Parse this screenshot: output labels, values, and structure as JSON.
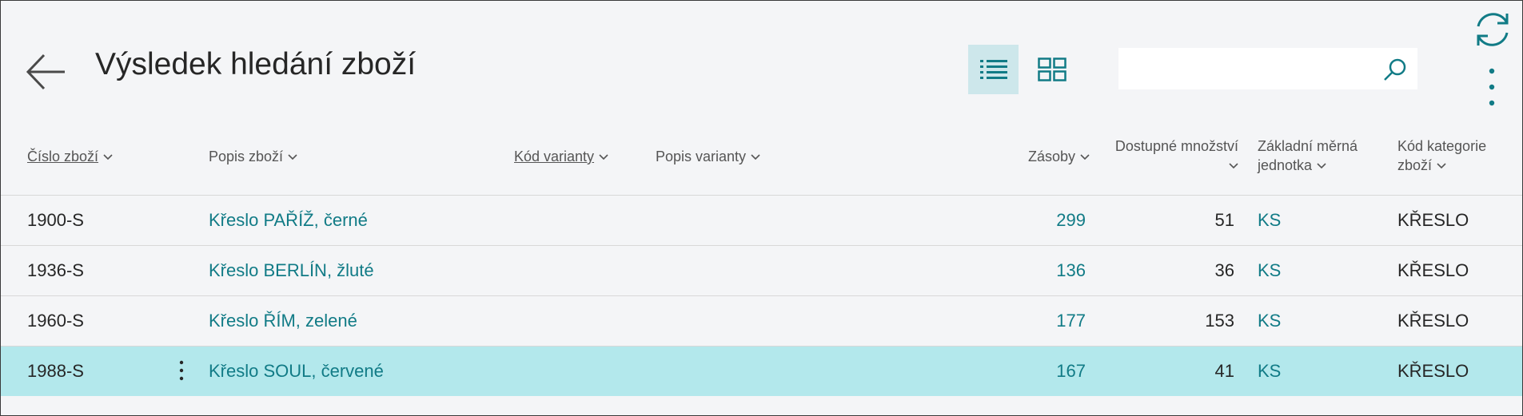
{
  "page": {
    "title": "Výsledek hledání zboží",
    "accent_color": "#117b86",
    "selected_row_color": "#b3e8ec"
  },
  "toolbar": {
    "back_icon": "arrow-left-icon",
    "list_view_icon": "list-icon",
    "tile_view_icon": "tiles-icon",
    "search_placeholder": "",
    "search_value": "",
    "search_icon": "search-icon",
    "refresh_icon": "refresh-icon",
    "more_icon": "more-vertical-icon"
  },
  "columns": {
    "item_no": "Číslo zboží",
    "description": "Popis zboží",
    "variant_code": "Kód varianty",
    "variant_desc": "Popis varianty",
    "inventory": "Zásoby",
    "available_line1": "Dostupné množství",
    "uom_line1": "Základní měrná",
    "uom_line2": "jednotka",
    "category_line1": "Kód kategorie",
    "category_line2": "zboží"
  },
  "rows": [
    {
      "item_no": "1900-S",
      "description": "Křeslo PAŘÍŽ, černé",
      "inventory": "299",
      "available": "51",
      "uom": "KS",
      "category": "KŘESLO"
    },
    {
      "item_no": "1936-S",
      "description": "Křeslo BERLÍN, žluté",
      "inventory": "136",
      "available": "36",
      "uom": "KS",
      "category": "KŘESLO"
    },
    {
      "item_no": "1960-S",
      "description": "Křeslo ŘÍM, zelené",
      "inventory": "177",
      "available": "153",
      "uom": "KS",
      "category": "KŘESLO"
    },
    {
      "item_no": "1988-S",
      "description": "Křeslo SOUL, červené",
      "inventory": "167",
      "available": "41",
      "uom": "KS",
      "category": "KŘESLO"
    }
  ]
}
